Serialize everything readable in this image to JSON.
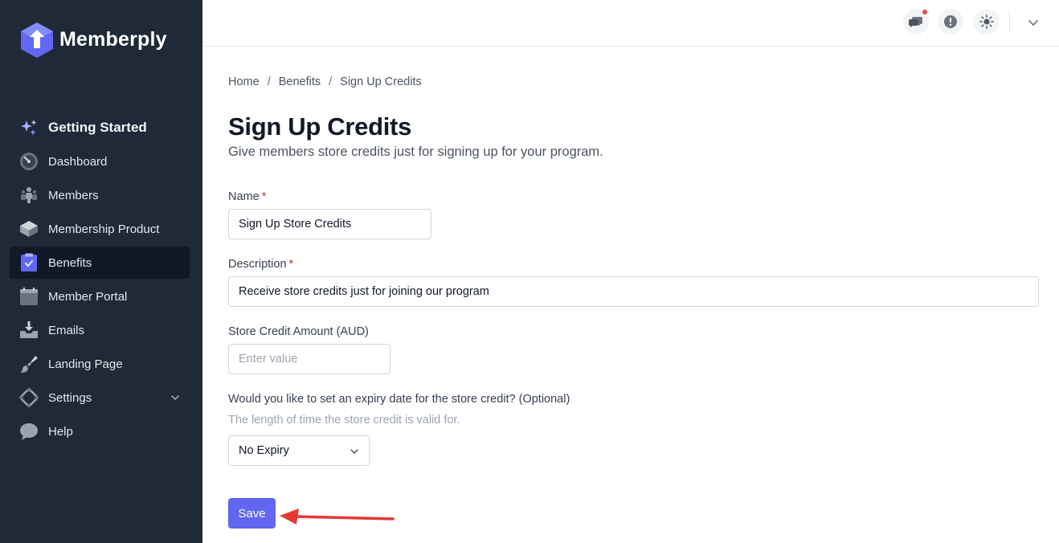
{
  "app": {
    "name": "Memberply"
  },
  "sidebar": {
    "items": [
      {
        "label": "Getting Started",
        "icon": "sparkles-icon"
      },
      {
        "label": "Dashboard",
        "icon": "gauge-icon"
      },
      {
        "label": "Members",
        "icon": "users-icon"
      },
      {
        "label": "Membership Product",
        "icon": "cube-icon"
      },
      {
        "label": "Benefits",
        "icon": "clipboard-check-icon",
        "active": true
      },
      {
        "label": "Member Portal",
        "icon": "calendar-icon"
      },
      {
        "label": "Emails",
        "icon": "inbox-download-icon"
      },
      {
        "label": "Landing Page",
        "icon": "paint-brush-icon"
      },
      {
        "label": "Settings",
        "icon": "settings-icon",
        "expandable": true
      },
      {
        "label": "Help",
        "icon": "chat-bubble-icon"
      }
    ]
  },
  "topbar": {
    "icons": [
      "chat-icon",
      "alert-icon",
      "sun-icon",
      "chevron-down-icon"
    ],
    "chat_has_notification": true
  },
  "breadcrumb": {
    "items": [
      "Home",
      "Benefits",
      "Sign Up Credits"
    ],
    "separator": "/"
  },
  "page": {
    "title": "Sign Up Credits",
    "subtitle": "Give members store credits just for signing up for your program."
  },
  "form": {
    "name": {
      "label": "Name",
      "required_mark": "*",
      "value": "Sign Up Store Credits"
    },
    "description": {
      "label": "Description",
      "required_mark": "*",
      "value": "Receive store credits just for joining our program"
    },
    "amount": {
      "label": "Store Credit Amount (AUD)",
      "placeholder": "Enter value",
      "value": ""
    },
    "expiry": {
      "label": "Would you like to set an expiry date for the store credit? (Optional)",
      "hint": "The length of time the store credit is valid for.",
      "selected": "No Expiry"
    },
    "save_label": "Save"
  },
  "colors": {
    "sidebar_bg": "#1f2937",
    "active_item_bg": "#111827",
    "accent": "#6366f1",
    "required": "#dc2626",
    "annotation_arrow": "#e53935"
  }
}
